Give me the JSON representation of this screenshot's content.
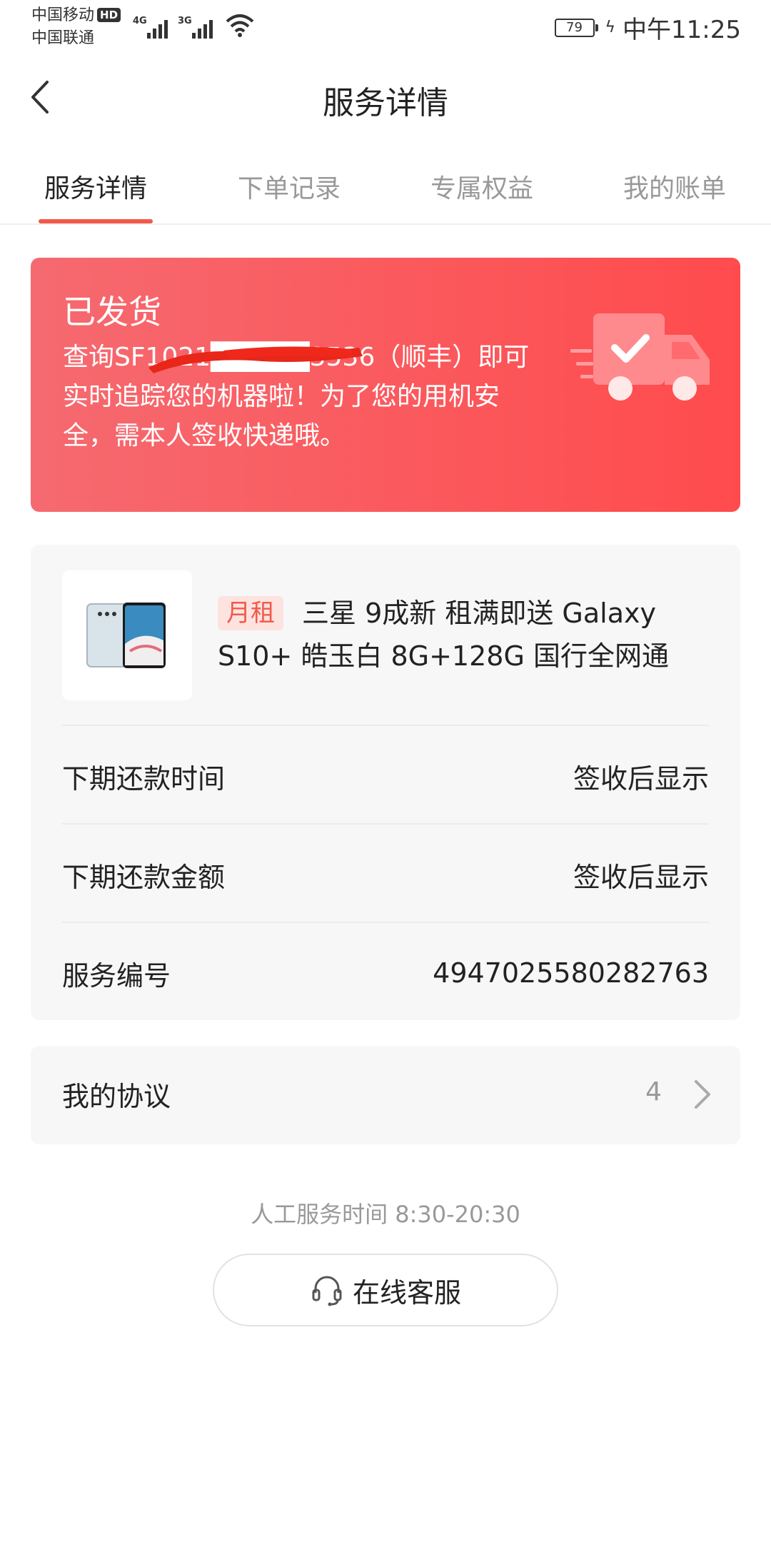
{
  "status_bar": {
    "carrier_1": "中国移动",
    "carrier_1_badge": "HD",
    "carrier_2": "中国联通",
    "signal_1_label": "4G",
    "signal_2_label": "3G",
    "battery": "79",
    "time": "中午11:25"
  },
  "header": {
    "title": "服务详情",
    "back_icon": "chevron-left-icon"
  },
  "tabs": [
    {
      "label": "服务详情",
      "active": true
    },
    {
      "label": "下单记录",
      "active": false
    },
    {
      "label": "专属权益",
      "active": false
    },
    {
      "label": "我的账单",
      "active": false
    }
  ],
  "shipment": {
    "status": "已发货",
    "message": "查询SF1021█████3536（顺丰）即可实时追踪您的机器啦！为了您的用机安全，需本人签收快递哦。",
    "icon": "delivery-truck-icon",
    "background_colors": [
      "#f56a70",
      "#ff4b4d"
    ]
  },
  "product": {
    "tag": "月租",
    "name": "三星 9成新 租满即送 Galaxy S10+ 皓玉白 8G+128G 国行全网通",
    "image_icon": "phone-image"
  },
  "details": [
    {
      "label": "下期还款时间",
      "value": "签收后显示"
    },
    {
      "label": "下期还款金额",
      "value": "签收后显示"
    },
    {
      "label": "服务编号",
      "value": "4947025580282763"
    }
  ],
  "agreements": {
    "label": "我的协议",
    "count": "4",
    "icon": "chevron-right-icon"
  },
  "service": {
    "hours": "人工服务时间 8:30-20:30",
    "button_label": "在线客服",
    "button_icon": "headset-icon"
  },
  "accent_color": "#f15a4a"
}
